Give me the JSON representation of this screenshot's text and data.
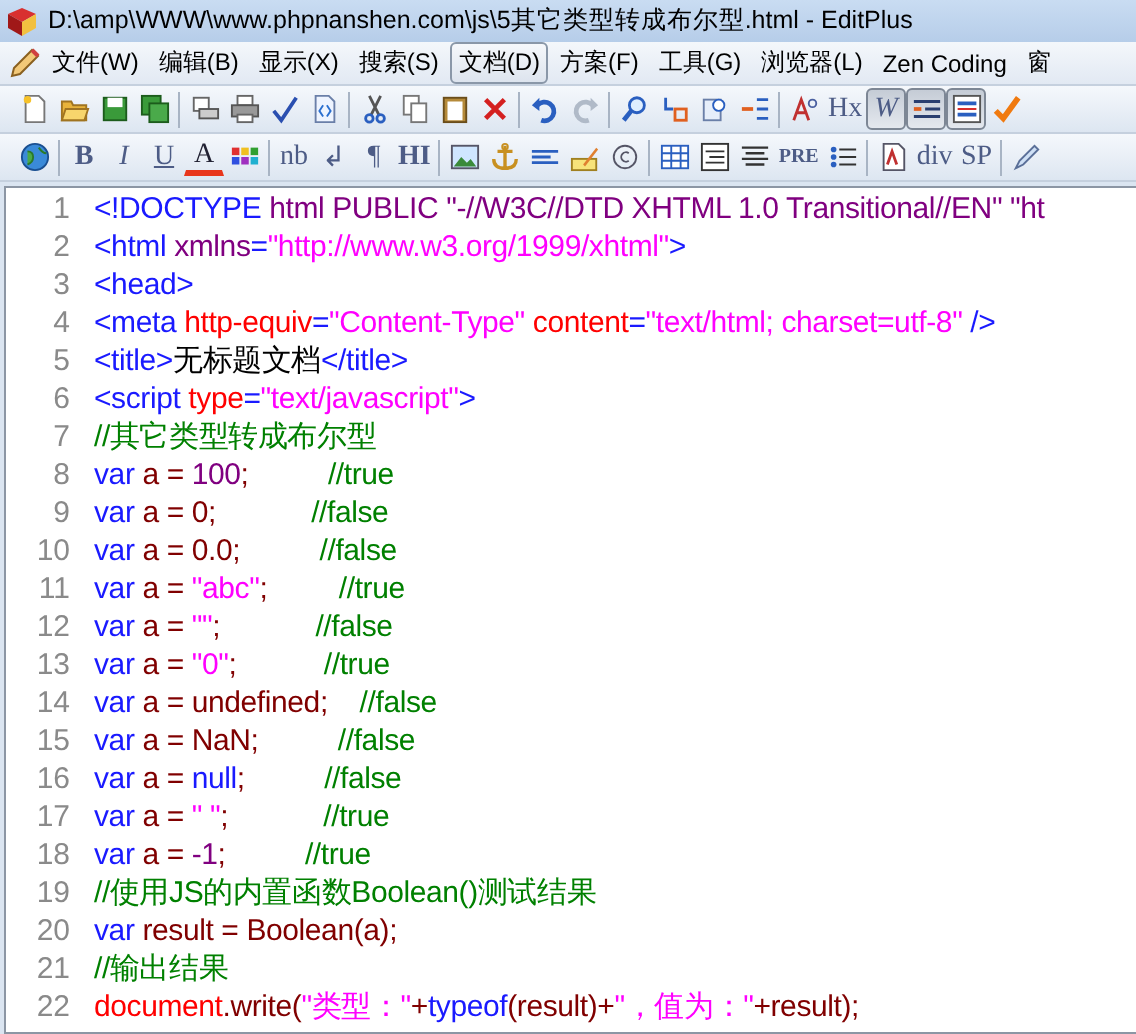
{
  "window": {
    "title": "D:\\amp\\WWW\\www.phpnanshen.com\\js\\5其它类型转成布尔型.html - EditPlus"
  },
  "menu": [
    {
      "label": "文件(W)",
      "selected": false
    },
    {
      "label": "编辑(B)",
      "selected": false
    },
    {
      "label": "显示(X)",
      "selected": false
    },
    {
      "label": "搜索(S)",
      "selected": false
    },
    {
      "label": "文档(D)",
      "selected": true
    },
    {
      "label": "方案(F)",
      "selected": false
    },
    {
      "label": "工具(G)",
      "selected": false
    },
    {
      "label": "浏览器(L)",
      "selected": false
    },
    {
      "label": "Zen Coding",
      "selected": false
    },
    {
      "label": "窗",
      "selected": false
    }
  ],
  "toolbars": [
    [
      {
        "kind": "icon",
        "pressed": false
      },
      {
        "kind": "icon",
        "pressed": false
      },
      {
        "kind": "icon",
        "pressed": false
      },
      {
        "kind": "icon",
        "pressed": false
      },
      {
        "kind": "separator"
      },
      {
        "kind": "icon",
        "pressed": false
      },
      {
        "kind": "icon",
        "pressed": false
      },
      {
        "kind": "icon",
        "pressed": false
      },
      {
        "kind": "icon",
        "pressed": false
      },
      {
        "kind": "separator"
      },
      {
        "kind": "icon",
        "pressed": false
      },
      {
        "kind": "icon",
        "pressed": false
      },
      {
        "kind": "icon",
        "pressed": false
      },
      {
        "kind": "icon",
        "pressed": false
      },
      {
        "kind": "separator"
      },
      {
        "kind": "icon",
        "pressed": false
      },
      {
        "kind": "icon",
        "pressed": false
      },
      {
        "kind": "separator"
      },
      {
        "kind": "icon",
        "pressed": false
      },
      {
        "kind": "icon",
        "pressed": false
      },
      {
        "kind": "icon",
        "pressed": false
      },
      {
        "kind": "icon",
        "pressed": false
      },
      {
        "kind": "separator"
      },
      {
        "kind": "icon",
        "pressed": false
      },
      {
        "kind": "text",
        "label": "Hx",
        "pressed": false
      },
      {
        "kind": "italic",
        "label": "W",
        "pressed": true
      },
      {
        "kind": "icon",
        "pressed": true
      },
      {
        "kind": "icon",
        "pressed": true
      },
      {
        "kind": "icon",
        "pressed": false
      }
    ],
    [
      {
        "kind": "icon",
        "pressed": false
      },
      {
        "kind": "separator"
      },
      {
        "kind": "bold",
        "label": "B",
        "pressed": false
      },
      {
        "kind": "italic",
        "label": "I",
        "pressed": false
      },
      {
        "kind": "underline",
        "label": "U",
        "pressed": false
      },
      {
        "kind": "colortext",
        "label": "A",
        "pressed": false
      },
      {
        "kind": "icon",
        "pressed": false
      },
      {
        "kind": "separator"
      },
      {
        "kind": "text",
        "label": "nb",
        "pressed": false
      },
      {
        "kind": "text",
        "label": "↲",
        "pressed": false
      },
      {
        "kind": "text",
        "label": "¶",
        "pressed": false
      },
      {
        "kind": "bold",
        "label": "HI",
        "pressed": false
      },
      {
        "kind": "separator"
      },
      {
        "kind": "icon",
        "pressed": false
      },
      {
        "kind": "icon",
        "pressed": false
      },
      {
        "kind": "icon",
        "pressed": false
      },
      {
        "kind": "icon",
        "pressed": false
      },
      {
        "kind": "icon",
        "pressed": false
      },
      {
        "kind": "separator"
      },
      {
        "kind": "icon",
        "pressed": false
      },
      {
        "kind": "icon",
        "pressed": false
      },
      {
        "kind": "icon",
        "pressed": false
      },
      {
        "kind": "small",
        "label": "PRE",
        "pressed": false
      },
      {
        "kind": "icon",
        "pressed": false
      },
      {
        "kind": "separator"
      },
      {
        "kind": "icon",
        "pressed": false
      },
      {
        "kind": "text",
        "label": "div",
        "pressed": false
      },
      {
        "kind": "text",
        "label": "SP",
        "pressed": false
      },
      {
        "kind": "separator"
      },
      {
        "kind": "icon",
        "pressed": false
      }
    ]
  ],
  "editor": {
    "lines": [
      {
        "number": "1",
        "tokens": [
          {
            "text": "<!DOCTYPE",
            "kind": "tag"
          },
          {
            "text": " html PUBLIC ",
            "kind": "attr"
          },
          {
            "text": "\"-//W3C//DTD XHTML 1.0 Transitional//EN\" \"ht",
            "kind": "attr"
          }
        ]
      },
      {
        "number": "2",
        "tokens": [
          {
            "text": "<html ",
            "kind": "tag"
          },
          {
            "text": "xmlns",
            "kind": "attr"
          },
          {
            "text": "=",
            "kind": "tag"
          },
          {
            "text": "\"http://www.w3.org/1999/xhtml\"",
            "kind": "str"
          },
          {
            "text": ">",
            "kind": "tag"
          }
        ]
      },
      {
        "number": "3",
        "tokens": [
          {
            "text": "<head>",
            "kind": "tag"
          }
        ]
      },
      {
        "number": "4",
        "tokens": [
          {
            "text": "<meta ",
            "kind": "tag"
          },
          {
            "text": "http-equiv",
            "kind": "attr2"
          },
          {
            "text": "=",
            "kind": "tag"
          },
          {
            "text": "\"Content-Type\" ",
            "kind": "str"
          },
          {
            "text": "content",
            "kind": "attr2"
          },
          {
            "text": "=",
            "kind": "tag"
          },
          {
            "text": "\"text/html; charset=utf-8\" ",
            "kind": "str"
          },
          {
            "text": "/>",
            "kind": "tag"
          }
        ]
      },
      {
        "number": "5",
        "tokens": [
          {
            "text": "<title>",
            "kind": "tag"
          },
          {
            "text": "无标题文档",
            "kind": "text"
          },
          {
            "text": "</title>",
            "kind": "tag"
          }
        ]
      },
      {
        "number": "6",
        "tokens": [
          {
            "text": "<script ",
            "kind": "tag"
          },
          {
            "text": "type",
            "kind": "attr2"
          },
          {
            "text": "=",
            "kind": "tag"
          },
          {
            "text": "\"text/javascript\"",
            "kind": "str"
          },
          {
            "text": ">",
            "kind": "tag"
          }
        ]
      },
      {
        "number": "7",
        "tokens": [
          {
            "text": "//其它类型转成布尔型",
            "kind": "cmt"
          }
        ]
      },
      {
        "number": "8",
        "tokens": [
          {
            "text": "var ",
            "kind": "kw"
          },
          {
            "text": "a = ",
            "kind": "plain"
          },
          {
            "text": "100",
            "kind": "num"
          },
          {
            "text": ";          ",
            "kind": "plain"
          },
          {
            "text": "//true",
            "kind": "cmt"
          }
        ]
      },
      {
        "number": "9",
        "tokens": [
          {
            "text": "var ",
            "kind": "kw"
          },
          {
            "text": "a = 0;            ",
            "kind": "plain"
          },
          {
            "text": "//false",
            "kind": "cmt"
          }
        ]
      },
      {
        "number": "10",
        "tokens": [
          {
            "text": "var ",
            "kind": "kw"
          },
          {
            "text": "a = 0.0;          ",
            "kind": "plain"
          },
          {
            "text": "//false",
            "kind": "cmt"
          }
        ]
      },
      {
        "number": "11",
        "tokens": [
          {
            "text": "var ",
            "kind": "kw"
          },
          {
            "text": "a = ",
            "kind": "plain"
          },
          {
            "text": "\"abc\"",
            "kind": "str"
          },
          {
            "text": ";         ",
            "kind": "plain"
          },
          {
            "text": "//true",
            "kind": "cmt"
          }
        ]
      },
      {
        "number": "12",
        "tokens": [
          {
            "text": "var ",
            "kind": "kw"
          },
          {
            "text": "a = ",
            "kind": "plain"
          },
          {
            "text": "\"\"",
            "kind": "str"
          },
          {
            "text": ";            ",
            "kind": "plain"
          },
          {
            "text": "//false",
            "kind": "cmt"
          }
        ]
      },
      {
        "number": "13",
        "tokens": [
          {
            "text": "var ",
            "kind": "kw"
          },
          {
            "text": "a = ",
            "kind": "plain"
          },
          {
            "text": "\"0\"",
            "kind": "str"
          },
          {
            "text": ";           ",
            "kind": "plain"
          },
          {
            "text": "//true",
            "kind": "cmt"
          }
        ]
      },
      {
        "number": "14",
        "tokens": [
          {
            "text": "var ",
            "kind": "kw"
          },
          {
            "text": "a = undefined;    ",
            "kind": "plain"
          },
          {
            "text": "//false",
            "kind": "cmt"
          }
        ]
      },
      {
        "number": "15",
        "tokens": [
          {
            "text": "var ",
            "kind": "kw"
          },
          {
            "text": "a = NaN;          ",
            "kind": "plain"
          },
          {
            "text": "//false",
            "kind": "cmt"
          }
        ]
      },
      {
        "number": "16",
        "tokens": [
          {
            "text": "var ",
            "kind": "kw"
          },
          {
            "text": "a = ",
            "kind": "plain"
          },
          {
            "text": "null",
            "kind": "kw"
          },
          {
            "text": ";          ",
            "kind": "plain"
          },
          {
            "text": "//false",
            "kind": "cmt"
          }
        ]
      },
      {
        "number": "17",
        "tokens": [
          {
            "text": "var ",
            "kind": "kw"
          },
          {
            "text": "a = ",
            "kind": "plain"
          },
          {
            "text": "\" \"",
            "kind": "str"
          },
          {
            "text": ";            ",
            "kind": "plain"
          },
          {
            "text": "//true",
            "kind": "cmt"
          }
        ]
      },
      {
        "number": "18",
        "tokens": [
          {
            "text": "var ",
            "kind": "kw"
          },
          {
            "text": "a = ",
            "kind": "plain"
          },
          {
            "text": "-1",
            "kind": "num"
          },
          {
            "text": ";          ",
            "kind": "plain"
          },
          {
            "text": "//true",
            "kind": "cmt"
          }
        ]
      },
      {
        "number": "19",
        "tokens": [
          {
            "text": "//使用JS的内置函数Boolean()测试结果",
            "kind": "cmt"
          }
        ]
      },
      {
        "number": "20",
        "tokens": [
          {
            "text": "var ",
            "kind": "kw"
          },
          {
            "text": "result = Boolean(a);",
            "kind": "plain"
          }
        ]
      },
      {
        "number": "21",
        "tokens": [
          {
            "text": "//输出结果",
            "kind": "cmt"
          }
        ]
      },
      {
        "number": "22",
        "tokens": [
          {
            "text": "document",
            "kind": "attr2"
          },
          {
            "text": ".write(",
            "kind": "plain"
          },
          {
            "text": "\"类型：\"",
            "kind": "str"
          },
          {
            "text": "+",
            "kind": "plain"
          },
          {
            "text": "typeof",
            "kind": "kw"
          },
          {
            "text": "(result)+",
            "kind": "plain"
          },
          {
            "text": "\"，值为：\"",
            "kind": "str"
          },
          {
            "text": "+result);",
            "kind": "plain"
          }
        ]
      }
    ]
  }
}
